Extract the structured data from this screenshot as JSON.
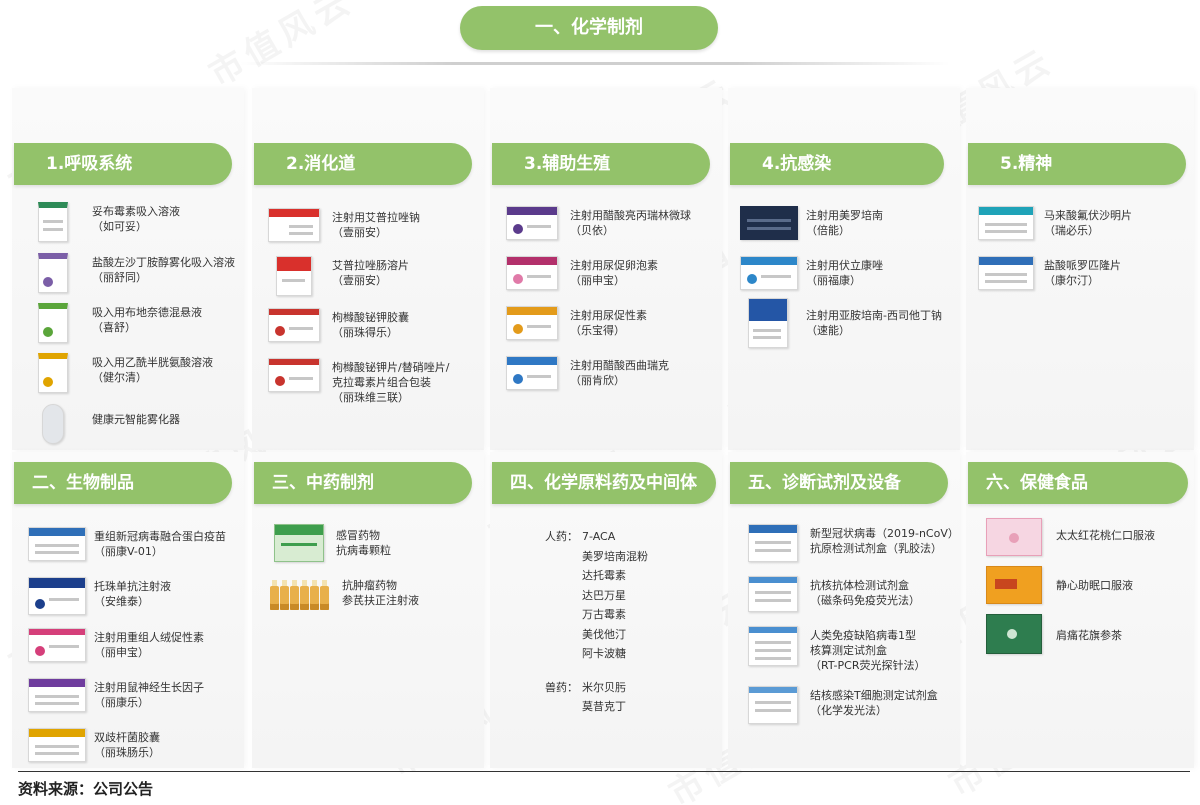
{
  "watermark_text": "市值风云",
  "main_title": "一、化学制剂",
  "chem_sections": [
    {
      "title": "1.呼吸系统",
      "items": [
        {
          "name": "妥布霉素吸入溶液",
          "sub": "（如可妥）",
          "color": "#2e8b57"
        },
        {
          "name": "盐酸左沙丁胺醇雾化吸入溶液",
          "sub": "（丽舒同）",
          "color": "#7b5ea7"
        },
        {
          "name": "吸入用布地奈德混悬液",
          "sub": "（喜舒）",
          "color": "#5aa53a"
        },
        {
          "name": "吸入用乙酰半胱氨酸溶液",
          "sub": "（健尔清）",
          "color": "#e0a400"
        },
        {
          "name": "健康元智能雾化器",
          "sub": "",
          "color": "#7f8c99"
        }
      ]
    },
    {
      "title": "2.消化道",
      "items": [
        {
          "name": "注射用艾普拉唑钠",
          "sub": "（壹丽安）",
          "color": "#d9302c"
        },
        {
          "name": "艾普拉唑肠溶片",
          "sub": "（壹丽安）",
          "color": "#d9302c"
        },
        {
          "name": "枸橼酸铋钾胶囊",
          "sub": "（丽珠得乐）",
          "color": "#c8342e"
        },
        {
          "name": "枸橼酸铋钾片/替硝唑片/",
          "sub": "克拉霉素片组合包装",
          "sub2": "（丽珠维三联）",
          "color": "#c8342e"
        }
      ]
    },
    {
      "title": "3.辅助生殖",
      "items": [
        {
          "name": "注射用醋酸亮丙瑞林微球",
          "sub": "（贝依）",
          "color": "#5b3b8c"
        },
        {
          "name": "注射用尿促卵泡素",
          "sub": "（丽申宝）",
          "color": "#b3306b"
        },
        {
          "name": "注射用尿促性素",
          "sub": "（乐宝得）",
          "color": "#e39b1b"
        },
        {
          "name": "注射用醋酸西曲瑞克",
          "sub": "（丽肯欣）",
          "color": "#2f78c4"
        }
      ]
    },
    {
      "title": "4.抗感染",
      "items": [
        {
          "name": "注射用美罗培南",
          "sub": "（倍能）",
          "color": "#1f2e4a"
        },
        {
          "name": "注射用伏立康唑",
          "sub": "（丽福康）",
          "color": "#2d87c9"
        },
        {
          "name": "注射用亚胺培南-西司他丁钠",
          "sub": "（速能）",
          "color": "#2456a6"
        }
      ]
    },
    {
      "title": "5.精神",
      "items": [
        {
          "name": "马来酸氟伏沙明片",
          "sub": "（瑞必乐）",
          "color": "#1fa3b8"
        },
        {
          "name": "盐酸哌罗匹隆片",
          "sub": "（康尔汀）",
          "color": "#2f6fb8"
        }
      ]
    }
  ],
  "bottom_sections": [
    {
      "title": "二、生物制品",
      "items": [
        {
          "name": "重组新冠病毒融合蛋白疫苗",
          "sub": "（丽康V-01）",
          "color": "#2f6fb8"
        },
        {
          "name": "托珠单抗注射液",
          "sub": "（安维泰）",
          "color": "#1c3f8c"
        },
        {
          "name": "注射用重组人绒促性素",
          "sub": "（丽申宝）",
          "color": "#d53f7a"
        },
        {
          "name": "注射用鼠神经生长因子",
          "sub": "（丽康乐）",
          "color": "#6f3c9e"
        },
        {
          "name": "双歧杆菌胶囊",
          "sub": "（丽珠肠乐）",
          "color": "#e0a400"
        }
      ]
    },
    {
      "title": "三、中药制剂",
      "items": [
        {
          "name": "感冒药物",
          "sub": "抗病毒颗粒",
          "color": "#3e9e4d"
        },
        {
          "name": "抗肿瘤药物",
          "sub": "参芪扶正注射液",
          "color": "#e8b04a"
        }
      ]
    },
    {
      "title": "四、化学原料药及中间体",
      "raw": {
        "human_label": "人药：",
        "human": [
          "7-ACA",
          "美罗培南混粉",
          "达托霉素",
          "达巴万星",
          "万古霉素",
          "美伐他汀",
          "阿卡波糖"
        ],
        "vet_label": "兽药：",
        "vet": [
          "米尔贝肟",
          "莫昔克丁"
        ]
      }
    },
    {
      "title": "五、诊断试剂及设备",
      "items": [
        {
          "name": "新型冠状病毒（2019-nCoV）",
          "sub": "抗原检测试剂盒（乳胶法）",
          "color": "#2f6fb8"
        },
        {
          "name": "抗核抗体检测试剂盒",
          "sub": "（磁条码免疫荧光法）",
          "color": "#4a8fd0"
        },
        {
          "name": "人类免疫缺陷病毒1型",
          "sub": "核算测定试剂盒",
          "sub2": "（RT-PCR荧光探针法）",
          "color": "#4a8fd0"
        },
        {
          "name": "结核感染T细胞测定试剂盒",
          "sub": "（化学发光法）",
          "color": "#5b9bd5"
        }
      ]
    },
    {
      "title": "六、保健食品",
      "items": [
        {
          "name": "太太红花桃仁口服液",
          "sub": "",
          "color": "#e8a0b8"
        },
        {
          "name": "静心助眠口服液",
          "sub": "",
          "color": "#f0a020"
        },
        {
          "name": "肩痛花旗参茶",
          "sub": "",
          "color": "#2e7d4f"
        }
      ]
    }
  ],
  "source_text": "资料来源：公司公告"
}
